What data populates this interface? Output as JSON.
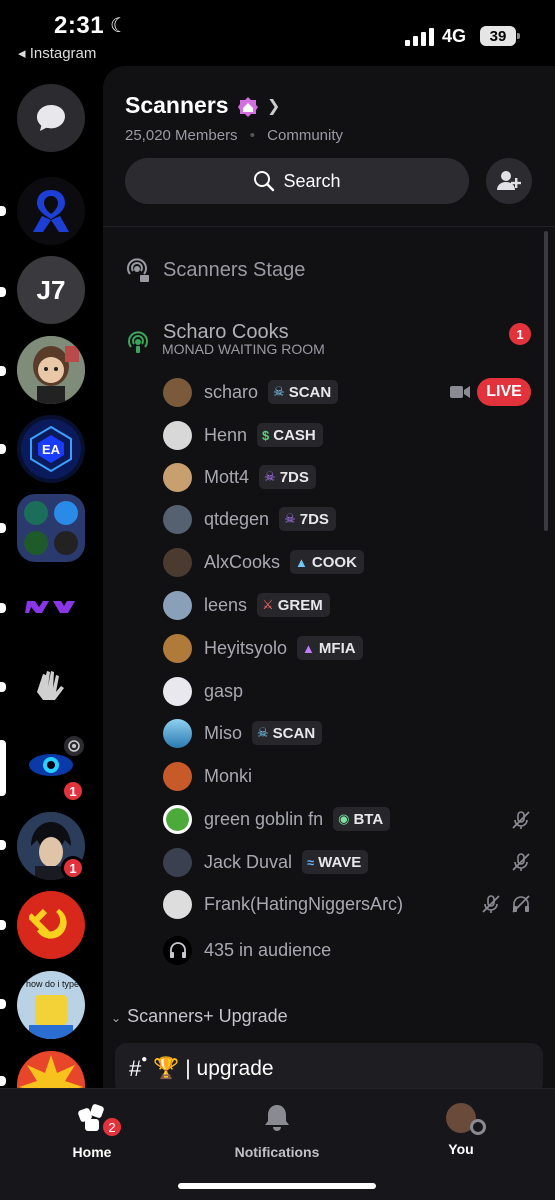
{
  "status_bar": {
    "time": "2:31",
    "back_app": "◂ Instagram",
    "network": "4G",
    "battery": "39"
  },
  "server": {
    "name": "Scanners",
    "members": "25,020 Members",
    "type": "Community"
  },
  "search": {
    "label": "Search"
  },
  "channels": {
    "stage": "Scanners Stage",
    "cooks": {
      "name": "Scharo Cooks",
      "topic": "MONAD WAITING ROOM",
      "badge": "1"
    },
    "audience": "435 in audience"
  },
  "live_label": "LIVE",
  "members": [
    {
      "name": "scharo",
      "tag": "SCAN",
      "tag_icon": "skull"
    },
    {
      "name": "Henn",
      "tag": "CASH",
      "tag_icon": "money"
    },
    {
      "name": "Mott4",
      "tag": "7DS",
      "tag_icon": "purple-skull"
    },
    {
      "name": "qtdegen",
      "tag": "7DS",
      "tag_icon": "purple-skull"
    },
    {
      "name": "AlxCooks",
      "tag": "COOK",
      "tag_icon": "mushroom"
    },
    {
      "name": "leens",
      "tag": "GREM",
      "tag_icon": "sword"
    },
    {
      "name": "Heyitsyolo",
      "tag": "MFIA",
      "tag_icon": "flame"
    },
    {
      "name": "gasp",
      "tag": "",
      "tag_icon": ""
    },
    {
      "name": "Miso",
      "tag": "SCAN",
      "tag_icon": "skull"
    },
    {
      "name": "Monki",
      "tag": "",
      "tag_icon": ""
    },
    {
      "name": "green goblin fn",
      "tag": "BTA",
      "tag_icon": "cat"
    },
    {
      "name": "Jack Duval",
      "tag": "WAVE",
      "tag_icon": "wave"
    },
    {
      "name": "Frank(HatingNiggersArc)",
      "tag": "",
      "tag_icon": ""
    }
  ],
  "category": {
    "name": "Scanners+ Upgrade",
    "channel": "🏆 | upgrade"
  },
  "rail": {
    "j7": "J7",
    "badges": [
      "1",
      "1"
    ],
    "avatar_caption": "how do i type"
  },
  "tabs": {
    "home": "Home",
    "home_badge": "2",
    "notifications": "Notifications",
    "you": "You"
  },
  "colors": {
    "accent_red": "#e2333d",
    "panel": "#111114",
    "stage_green": "#3ba55d"
  }
}
